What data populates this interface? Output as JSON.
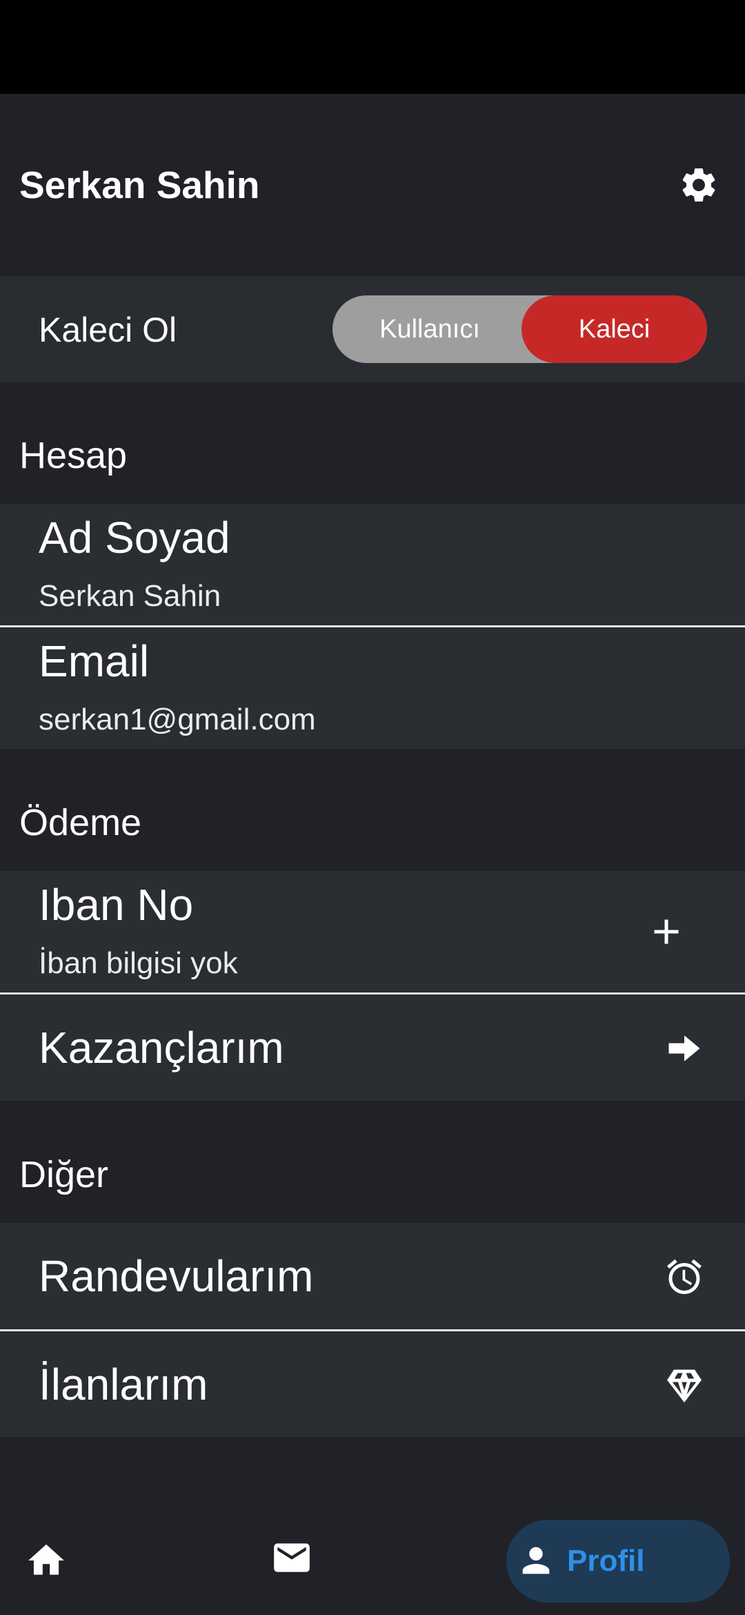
{
  "app_bar": {
    "title": "Serkan Sahin"
  },
  "role_toggle": {
    "label": "Kaleci Ol",
    "options": [
      "Kullanıcı",
      "Kaleci"
    ],
    "selected": "Kaleci"
  },
  "sections": {
    "account": {
      "title": "Hesap",
      "items": [
        {
          "title": "Ad Soyad",
          "subtitle": "Serkan Sahin"
        },
        {
          "title": "Email",
          "subtitle": "serkan1@gmail.com"
        }
      ]
    },
    "payment": {
      "title": "Ödeme",
      "items": [
        {
          "title": "Iban No",
          "subtitle": "İban bilgisi yok",
          "icon": "add-icon"
        },
        {
          "title": "Kazançlarım",
          "icon": "arrow-right-icon"
        }
      ]
    },
    "other": {
      "title": "Diğer",
      "items": [
        {
          "title": "Randevularım",
          "icon": "alarm-icon"
        },
        {
          "title": "İlanlarım",
          "icon": "diamond-icon"
        }
      ]
    }
  },
  "bottom_nav": {
    "items": [
      {
        "icon": "home-icon"
      },
      {
        "icon": "mail-icon"
      },
      {
        "icon": "person-icon",
        "label": "Profil",
        "active": true
      }
    ],
    "active_color": "#2f8fe8"
  },
  "colors": {
    "accent_red": "#c62828",
    "toggle_off": "#9e9e9e",
    "tile_bg": "#2a2d32",
    "page_bg": "#202227"
  }
}
